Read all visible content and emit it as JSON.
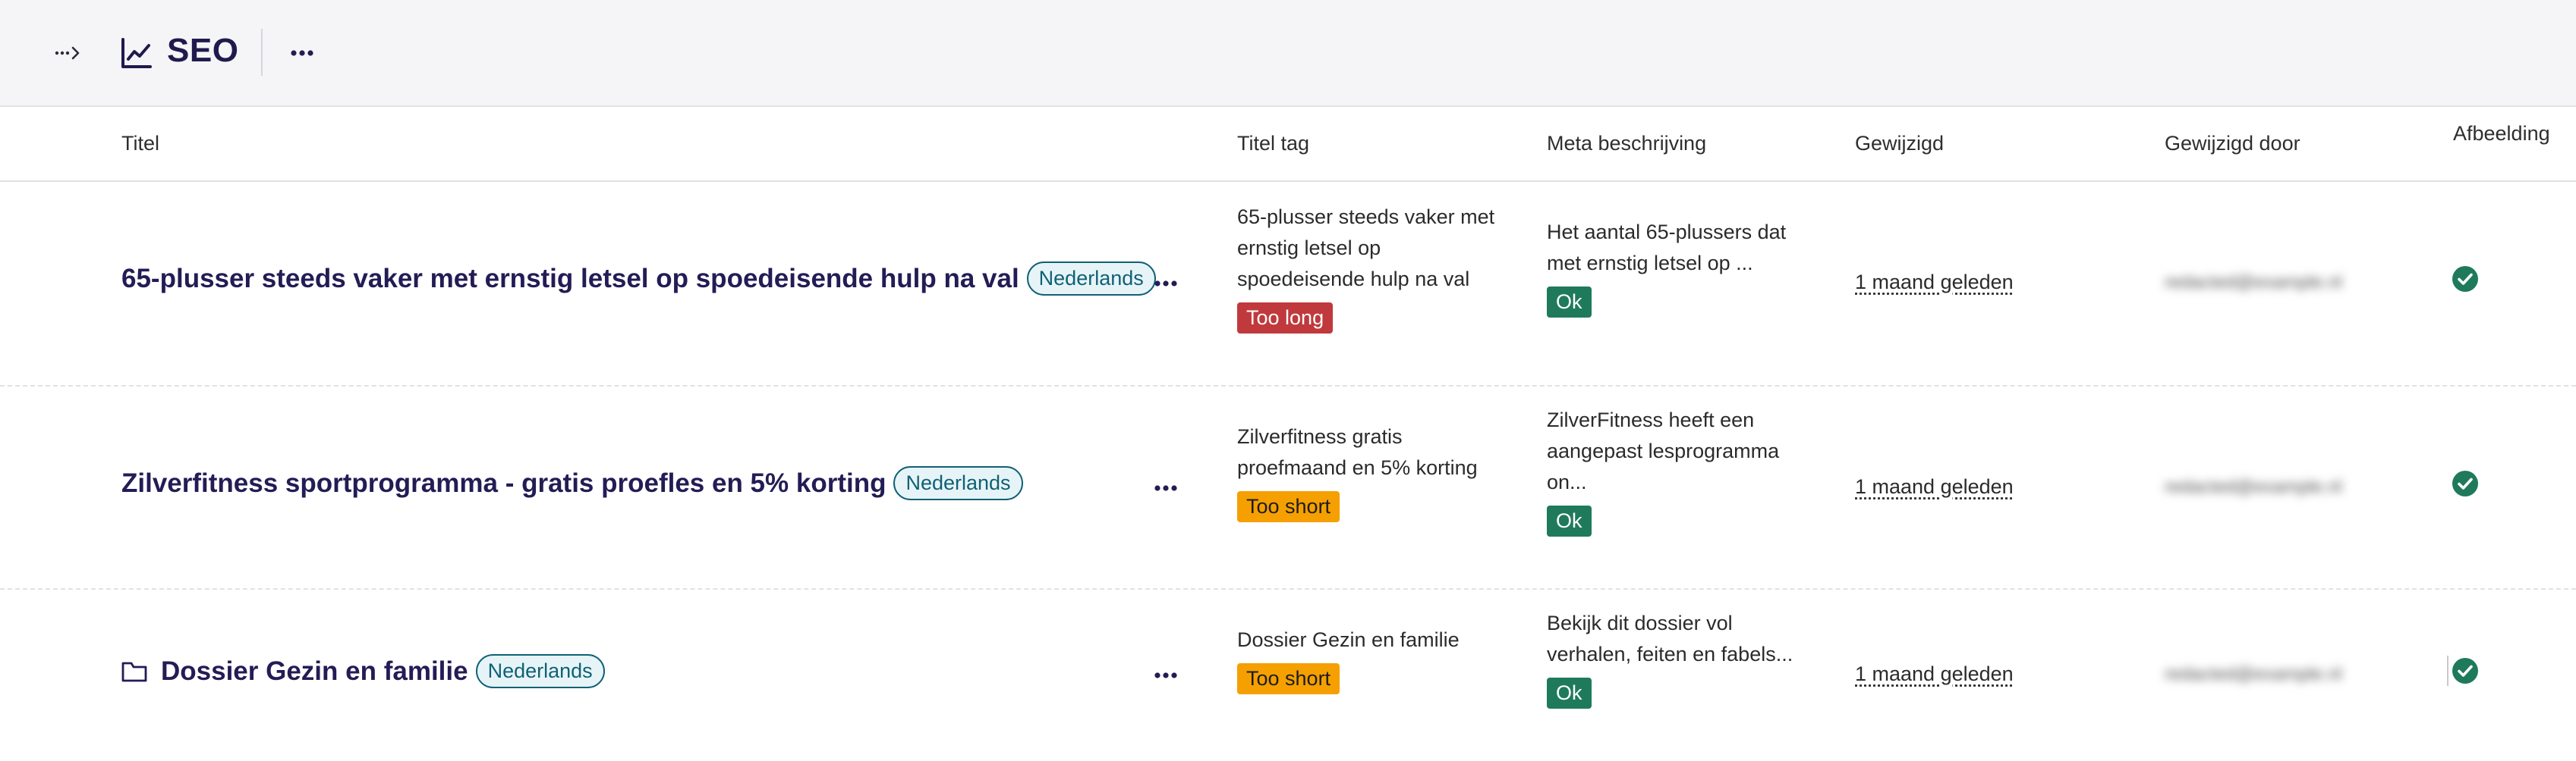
{
  "header": {
    "title": "SEO",
    "expand_icon": "expand-sidebar-icon",
    "title_icon": "line-chart-icon",
    "more_icon": "ellipsis-icon"
  },
  "table": {
    "columns": [
      "Titel",
      "Titel tag",
      "Meta beschrijving",
      "Gewijzigd",
      "Gewijzigd door",
      "Afbeelding"
    ],
    "rows": [
      {
        "title": "65-plusser steeds vaker met ernstig letsel op spoedeisende hulp na val",
        "language": "Nederlands",
        "title_tag_lines": [
          "65-plusser steeds vaker met",
          "ernstig letsel op",
          "spoedeisende hulp na val"
        ],
        "title_tag_status": "Too long",
        "meta_lines": [
          "Het aantal 65-plussers dat",
          "met ernstig letsel op ..."
        ],
        "meta_status": "Ok",
        "modified": "1 maand geleden",
        "modified_by": "(blurred)",
        "image_ok": true
      },
      {
        "title": "Zilverfitness sportprogramma - gratis proefles en 5% korting",
        "language": "Nederlands",
        "title_tag_lines": [
          "Zilverfitness gratis",
          "proefmaand en 5% korting"
        ],
        "title_tag_status": "Too short",
        "meta_lines": [
          "ZilverFitness heeft een",
          "aangepast lesprogramma",
          "on..."
        ],
        "meta_status": "Ok",
        "modified": "1 maand geleden",
        "modified_by": "(blurred)",
        "image_ok": true
      },
      {
        "title": "Dossier Gezin en familie",
        "language": "Nederlands",
        "title_tag_lines": [
          "Dossier Gezin en familie"
        ],
        "title_tag_status": "Too short",
        "meta_lines": [
          "Bekijk dit dossier vol",
          "verhalen, feiten en fabels..."
        ],
        "meta_status": "Ok",
        "modified": "1 maand geleden",
        "modified_by": "(blurred)",
        "image_ok": true
      }
    ]
  },
  "colors": {
    "too_long": "#c0393c",
    "too_short": "#f5a000",
    "ok": "#1f7a5c",
    "title": "#231c55",
    "badge": "#0f6176"
  }
}
